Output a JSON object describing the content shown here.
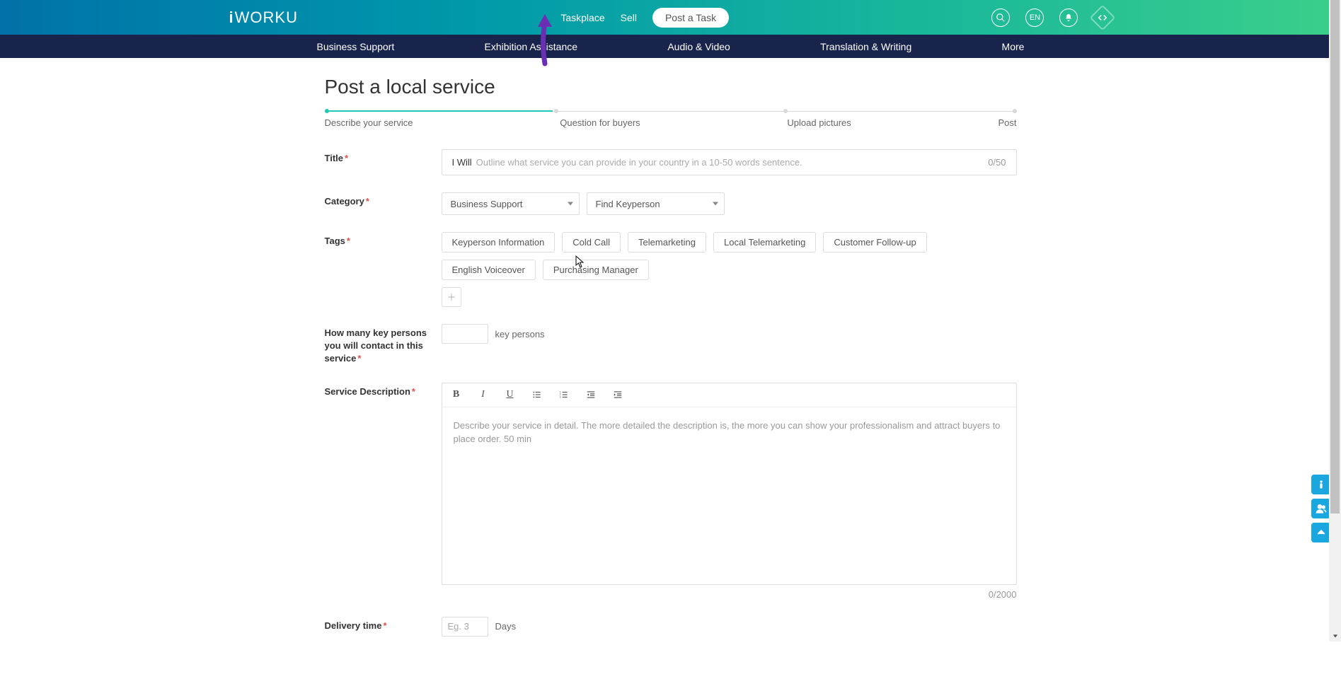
{
  "header": {
    "logo_text": "iWORKU",
    "nav": {
      "taskplace": "Taskplace",
      "sell": "Sell",
      "post_task": "Post a Task"
    },
    "lang": "EN"
  },
  "subnav": {
    "items": [
      "Business Support",
      "Exhibition Assistance",
      "Audio & Video",
      "Translation & Writing",
      "More"
    ]
  },
  "page": {
    "title": "Post a local service"
  },
  "progress": {
    "steps": [
      "Describe your service",
      "Question for buyers",
      "Upload pictures",
      "Post"
    ]
  },
  "form": {
    "title": {
      "label": "Title",
      "prefix": "I Will",
      "placeholder": "Outline what service you can provide in your country in a 10-50 words sentence.",
      "count": "0/50"
    },
    "category": {
      "label": "Category",
      "sel1": "Business Support",
      "sel2": "Find Keyperson"
    },
    "tags": {
      "label": "Tags",
      "items": [
        "Keyperson Information",
        "Cold Call",
        "Telemarketing",
        "Local Telemarketing",
        "Customer Follow-up",
        "English Voiceover",
        "Purchasing Manager"
      ]
    },
    "keypersons": {
      "label": "How many key persons you will contact in this service",
      "suffix": "key persons"
    },
    "description": {
      "label": "Service Description",
      "placeholder": "Describe your service in detail. The more detailed the description is, the more you can show your professionalism and attract buyers to place order. 50 min",
      "count": "0/2000"
    },
    "delivery": {
      "label": "Delivery time",
      "placeholder": "Eg. 3",
      "suffix": "Days"
    }
  }
}
